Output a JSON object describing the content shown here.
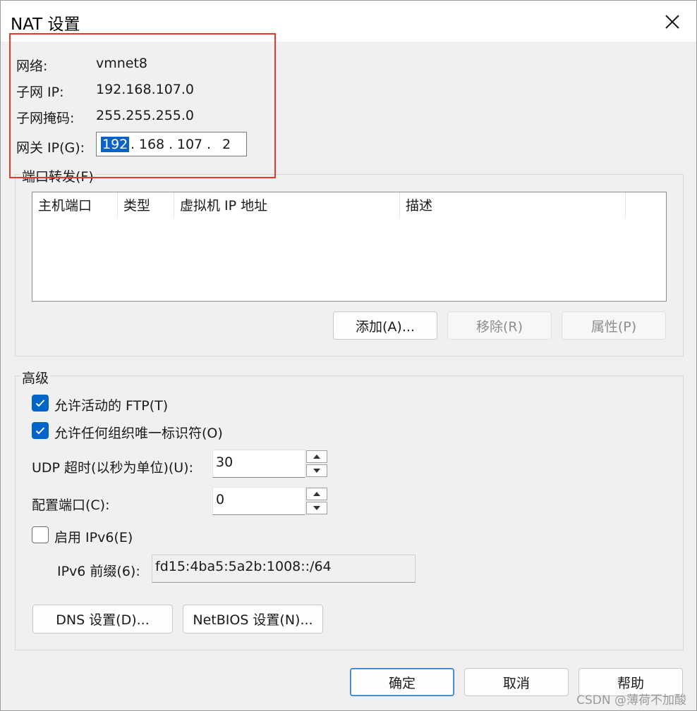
{
  "window": {
    "title": "NAT 设置"
  },
  "network_info": {
    "network_label": "网络:",
    "network_value": "vmnet8",
    "subnet_ip_label": "子网 IP:",
    "subnet_ip_value": "192.168.107.0",
    "subnet_mask_label": "子网掩码:",
    "subnet_mask_value": "255.255.255.0",
    "gateway_label": "网关 IP(G):",
    "gateway_octets": [
      "192",
      "168",
      "107",
      "2"
    ],
    "gateway_dot": "."
  },
  "port_forwarding": {
    "group_label": "端口转发(F)",
    "columns": [
      "主机端口",
      "类型",
      "虚拟机 IP 地址",
      "描述"
    ],
    "rows": [],
    "add_button": "添加(A)...",
    "remove_button": "移除(R)",
    "properties_button": "属性(P)"
  },
  "advanced": {
    "group_label": "高级",
    "allow_active_ftp": {
      "label": "允许活动的 FTP(T)",
      "checked": true
    },
    "allow_any_oui": {
      "label": "允许任何组织唯一标识符(O)",
      "checked": true
    },
    "udp_timeout_label": "UDP 超时(以秒为单位)(U):",
    "udp_timeout_value": "30",
    "config_port_label": "配置端口(C):",
    "config_port_value": "0",
    "enable_ipv6": {
      "label": "启用 IPv6(E)",
      "checked": false
    },
    "ipv6_prefix_label": "IPv6 前缀(6):",
    "ipv6_prefix_value": "fd15:4ba5:5a2b:1008::/64",
    "dns_button": "DNS 设置(D)...",
    "netbios_button": "NetBIOS 设置(N)..."
  },
  "footer": {
    "ok_button": "确定",
    "cancel_button": "取消",
    "help_button": "帮助"
  },
  "watermark": "CSDN @薄荷不加酸",
  "colors": {
    "highlight_box": "#e63a2a",
    "checkbox_checked": "#0064c8",
    "selection": "#0a64c8"
  }
}
